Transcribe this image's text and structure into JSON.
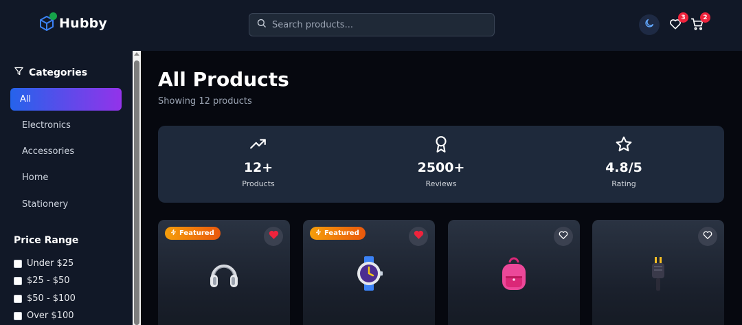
{
  "header": {
    "brand": "Hubby",
    "search_placeholder": "Search products...",
    "wishlist_count": "3",
    "cart_count": "2"
  },
  "sidebar": {
    "categories_title": "Categories",
    "categories": [
      "All",
      "Electronics",
      "Accessories",
      "Home",
      "Stationery"
    ],
    "active_category": "All",
    "price_title": "Price Range",
    "price_ranges": [
      "Under $25",
      "$25 - $50",
      "$50 - $100",
      "Over $100"
    ]
  },
  "main": {
    "title": "All Products",
    "subtitle": "Showing 12 products",
    "stats": [
      {
        "icon": "trending-up-icon",
        "value": "12+",
        "label": "Products"
      },
      {
        "icon": "award-icon",
        "value": "2500+",
        "label": "Reviews"
      },
      {
        "icon": "star-icon",
        "value": "4.8/5",
        "label": "Rating"
      }
    ],
    "featured_label": "Featured",
    "products": [
      {
        "icon": "headphones-icon",
        "featured": true,
        "favorited": true
      },
      {
        "icon": "watch-icon",
        "featured": true,
        "favorited": true
      },
      {
        "icon": "backpack-icon",
        "featured": false,
        "favorited": false
      },
      {
        "icon": "plug-icon",
        "featured": false,
        "favorited": false
      }
    ]
  },
  "colors": {
    "accent_start": "#2563eb",
    "accent_end": "#9333ea",
    "badge": "#ef233c",
    "featured_start": "#f59e0b",
    "featured_end": "#ea580c",
    "heart_active": "#ef233c"
  }
}
